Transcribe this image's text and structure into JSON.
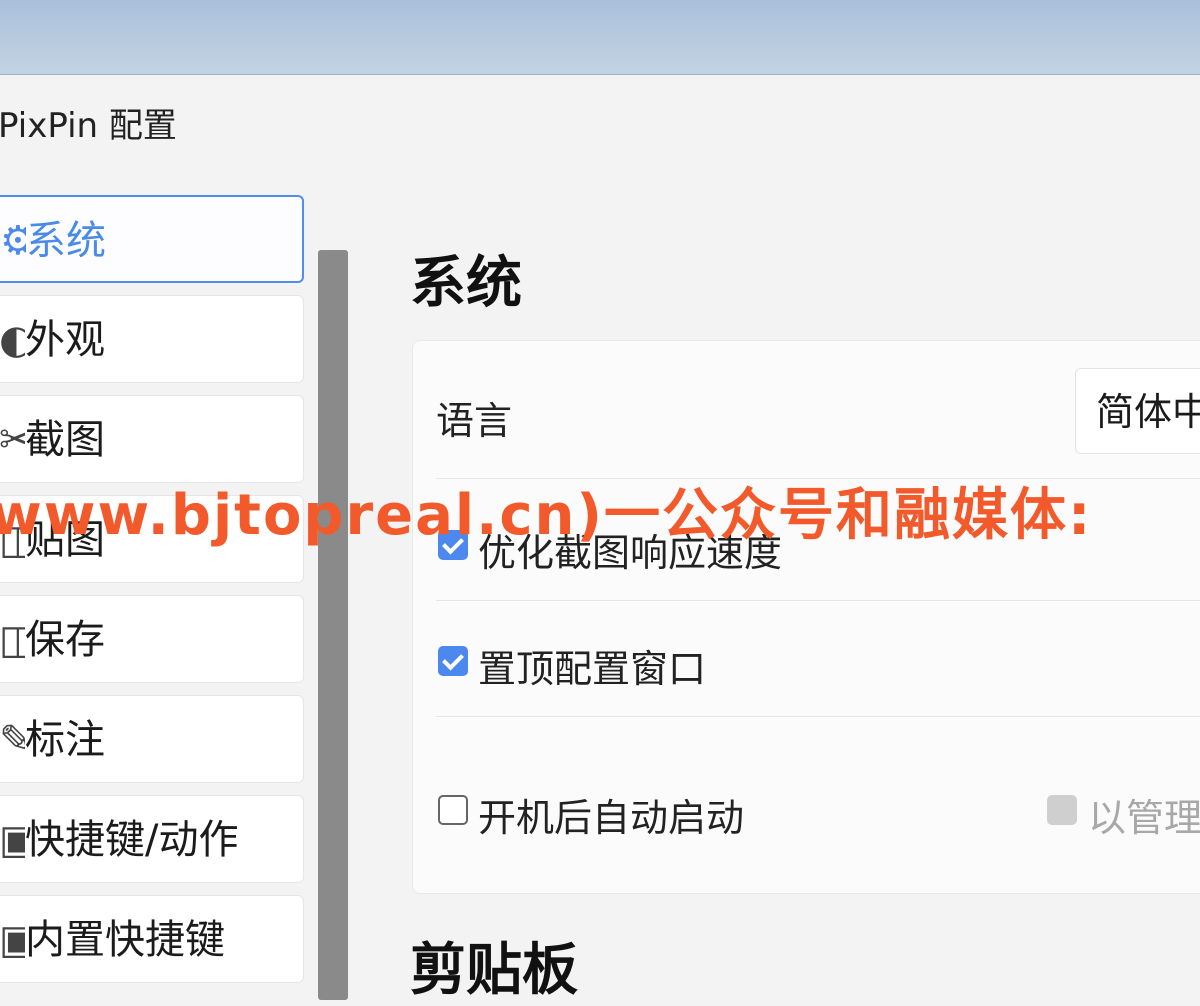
{
  "window": {
    "title": "PixPin 配置"
  },
  "sidebar": {
    "items": [
      {
        "icon": "gear-icon",
        "label": "系统",
        "active": true
      },
      {
        "icon": "palette-icon",
        "label": "外观"
      },
      {
        "icon": "scissors-icon",
        "label": "截图"
      },
      {
        "icon": "pin-icon",
        "label": "贴图"
      },
      {
        "icon": "save-icon",
        "label": "保存"
      },
      {
        "icon": "pen-icon",
        "label": "标注"
      },
      {
        "icon": "keyboard-icon",
        "label": "快捷键/动作"
      },
      {
        "icon": "keyboard-icon",
        "label": "内置快捷键"
      }
    ]
  },
  "main": {
    "section_title": "系统",
    "language": {
      "label": "语言",
      "value": "简体中"
    },
    "options": [
      {
        "label": "优化截图响应速度",
        "checked": true
      },
      {
        "label": "置顶配置窗口",
        "checked": true
      },
      {
        "label": "开机后自动启动",
        "checked": false
      }
    ],
    "admin_option": {
      "label": "以管理",
      "checked": false,
      "disabled": true
    },
    "next_section_title": "剪贴板"
  },
  "watermark": {
    "text": "www.bjtopreal.cn)一公众号和融媒体:"
  },
  "colors": {
    "accent": "#4d88ee",
    "watermark": "#f25a2c"
  }
}
